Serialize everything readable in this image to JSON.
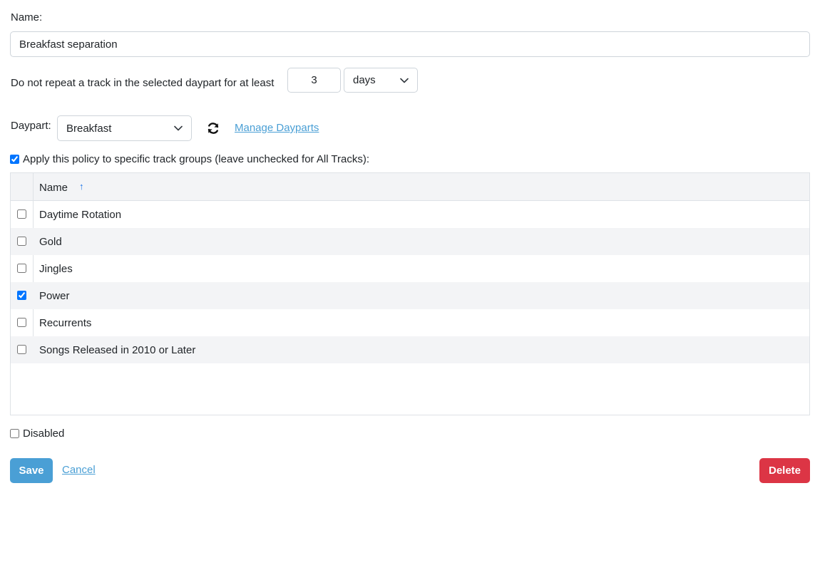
{
  "form": {
    "name_label": "Name:",
    "name_value": "Breakfast separation",
    "repeat_text": "Do not repeat a track in the selected daypart for at least",
    "repeat_value": "3",
    "repeat_unit": "days",
    "daypart_label": "Daypart:",
    "daypart_value": "Breakfast",
    "manage_dayparts_label": "Manage Dayparts",
    "apply_policy_label": "Apply this policy to specific track groups (leave unchecked for All Tracks):",
    "apply_policy_checked": true,
    "disabled_label": "Disabled",
    "disabled_checked": false
  },
  "grid": {
    "column_header": "Name",
    "sort_icon": "arrow-up-icon",
    "rows": [
      {
        "label": "Daytime Rotation",
        "checked": false
      },
      {
        "label": "Gold",
        "checked": false
      },
      {
        "label": "Jingles",
        "checked": false
      },
      {
        "label": "Power",
        "checked": true
      },
      {
        "label": "Recurrents",
        "checked": false
      },
      {
        "label": "Songs Released in 2010 or Later",
        "checked": false
      }
    ]
  },
  "actions": {
    "save_label": "Save",
    "cancel_label": "Cancel",
    "delete_label": "Delete"
  },
  "colors": {
    "primary": "#4a9fd5",
    "danger": "#dc3545",
    "sort_arrow": "#1a73e8",
    "row_alt_bg": "#f3f4f6"
  }
}
